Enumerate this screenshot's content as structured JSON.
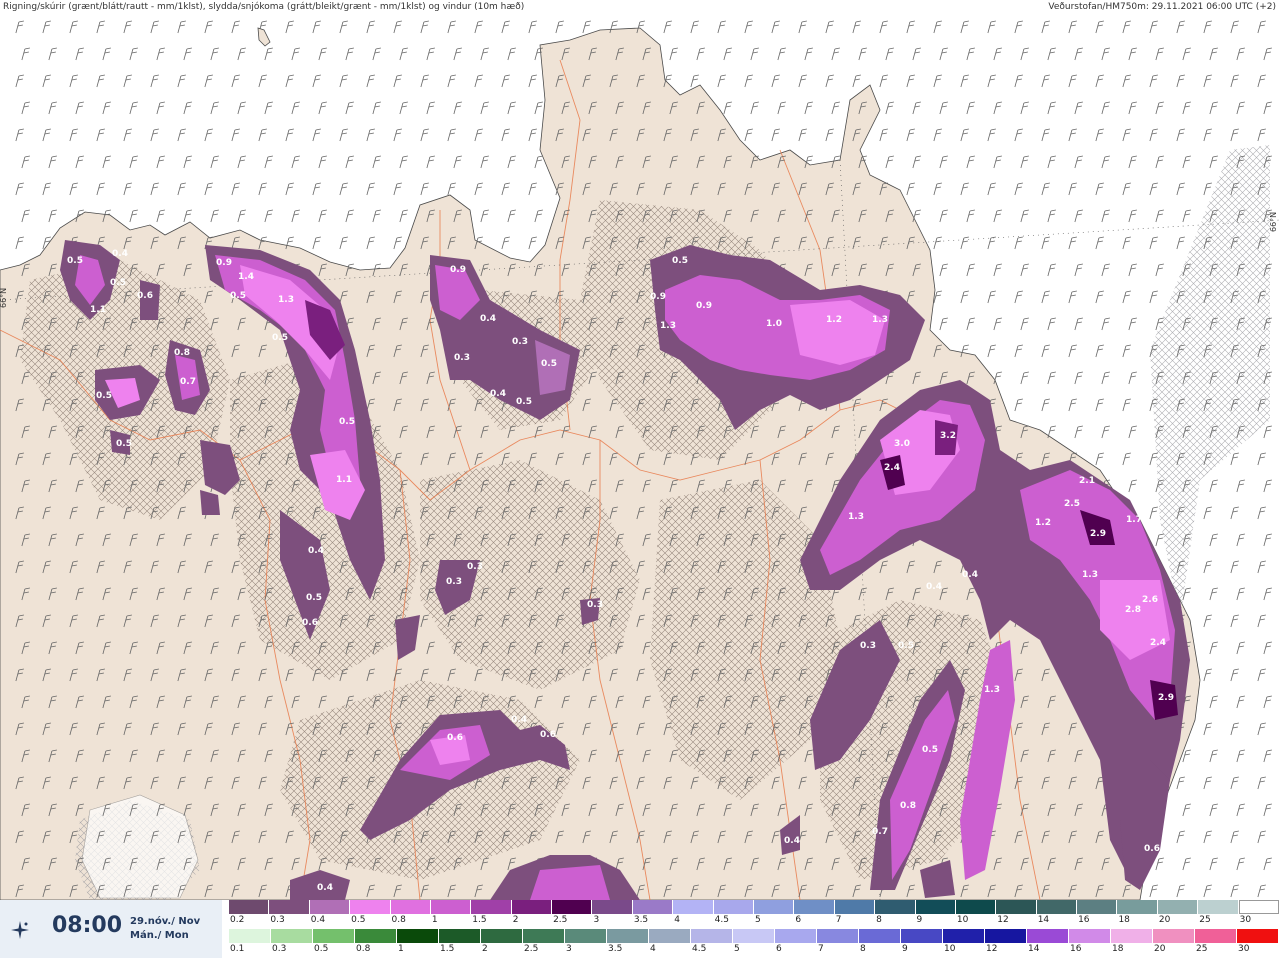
{
  "header": {
    "left_title": "Rigning/skúrir (grænt/blátt/rautt - mm/1klst), slydda/snjókoma (grátt/bleikt/grænt - mm/1klst) og vindur (10m hæð)",
    "right_title": "Veðurstofan/HM750m: 29.11.2021 06:00 UTC (+2)"
  },
  "time_panel": {
    "time": "08:00",
    "date_line1": "29.nóv./ Nov",
    "date_line2": "Mán./ Mon",
    "icon": "shower-sparkle-icon"
  },
  "map": {
    "latitude_label": "66°N",
    "precip_labels": [
      "0.5",
      "0.4",
      "0.5",
      "0.6",
      "1.1",
      "0.9",
      "1.4",
      "0.5",
      "1.3",
      "0.5",
      "0.9",
      "0.4",
      "0.3",
      "0.3",
      "0.4",
      "0.5",
      "0.5",
      "0.5",
      "0.9",
      "1.3",
      "0.9",
      "1.0",
      "1.2",
      "1.3",
      "0.8",
      "0.7",
      "0.5",
      "0.5",
      "1.1",
      "0.5",
      "0.4",
      "0.5",
      "0.3",
      "0.3",
      "0.3",
      "3.0",
      "3.2",
      "2.4",
      "1.3",
      "2.1",
      "2.5",
      "1.7",
      "2.9",
      "1.2",
      "1.3",
      "0.4",
      "0.4",
      "2.6",
      "2.8",
      "2.4",
      "0.3",
      "0.5",
      "1.3",
      "2.9",
      "0.4",
      "0.6",
      "0.4",
      "0.6",
      "0.5",
      "0.8",
      "0.7",
      "0.6",
      "0.4",
      "0.6"
    ],
    "colors": {
      "sea": "#ffffff",
      "land": "#efe3d6",
      "snow_light": "#7a4c7a",
      "snow_mid": "#cc5fd0",
      "snow_high": "#ee82ee",
      "roads": "#e87a4a"
    }
  },
  "legend": {
    "snow": [
      {
        "label": "0.2",
        "color": "#6e4a6e"
      },
      {
        "label": "0.3",
        "color": "#7d4f7d"
      },
      {
        "label": "0.4",
        "color": "#b06fb6"
      },
      {
        "label": "0.5",
        "color": "#ee82ee"
      },
      {
        "label": "0.8",
        "color": "#e070e0"
      },
      {
        "label": "1",
        "color": "#cc5fd0"
      },
      {
        "label": "1.5",
        "color": "#a040a8"
      },
      {
        "label": "2",
        "color": "#7a1f7e"
      },
      {
        "label": "2.5",
        "color": "#500050"
      },
      {
        "label": "3",
        "color": "#7a4a8a"
      },
      {
        "label": "3.5",
        "color": "#9a7ac8"
      },
      {
        "label": "4",
        "color": "#b3b3f5"
      },
      {
        "label": "4.5",
        "color": "#a8a8ec"
      },
      {
        "label": "5",
        "color": "#8f9fdf"
      },
      {
        "label": "6",
        "color": "#6f8fc6"
      },
      {
        "label": "7",
        "color": "#4f7aa8"
      },
      {
        "label": "8",
        "color": "#2f5c70"
      },
      {
        "label": "9",
        "color": "#124d58"
      },
      {
        "label": "10",
        "color": "#0e4a4c"
      },
      {
        "label": "12",
        "color": "#2c5656"
      },
      {
        "label": "14",
        "color": "#416868"
      },
      {
        "label": "16",
        "color": "#5c7f82"
      },
      {
        "label": "18",
        "color": "#789c9c"
      },
      {
        "label": "20",
        "color": "#93b0b0"
      },
      {
        "label": "25",
        "color": "#bcd0d0"
      },
      {
        "label": "30",
        "color": "#ffffff"
      }
    ],
    "rain": [
      {
        "label": "0.1",
        "color": "#ddf5dd"
      },
      {
        "label": "0.3",
        "color": "#a8dca0"
      },
      {
        "label": "0.5",
        "color": "#74c06c"
      },
      {
        "label": "0.8",
        "color": "#3a8a3a"
      },
      {
        "label": "1",
        "color": "#0a4a0a"
      },
      {
        "label": "1.5",
        "color": "#1c5a28"
      },
      {
        "label": "2",
        "color": "#2e6a40"
      },
      {
        "label": "2.5",
        "color": "#3e7a56"
      },
      {
        "label": "3",
        "color": "#5a8a7a"
      },
      {
        "label": "3.5",
        "color": "#7a9aa0"
      },
      {
        "label": "4",
        "color": "#9aaac0"
      },
      {
        "label": "4.5",
        "color": "#b5b5e8"
      },
      {
        "label": "5",
        "color": "#c8c8f5"
      },
      {
        "label": "6",
        "color": "#a8a8ee"
      },
      {
        "label": "7",
        "color": "#8888e0"
      },
      {
        "label": "8",
        "color": "#6a6ad6"
      },
      {
        "label": "9",
        "color": "#4848c4"
      },
      {
        "label": "10",
        "color": "#2020aa"
      },
      {
        "label": "12",
        "color": "#1616a0"
      },
      {
        "label": "14",
        "color": "#9a4ad6"
      },
      {
        "label": "16",
        "color": "#d18ae8"
      },
      {
        "label": "18",
        "color": "#f0b0e8"
      },
      {
        "label": "20",
        "color": "#f090c0"
      },
      {
        "label": "25",
        "color": "#f06098"
      },
      {
        "label": "30",
        "color": "#f01010"
      }
    ]
  }
}
